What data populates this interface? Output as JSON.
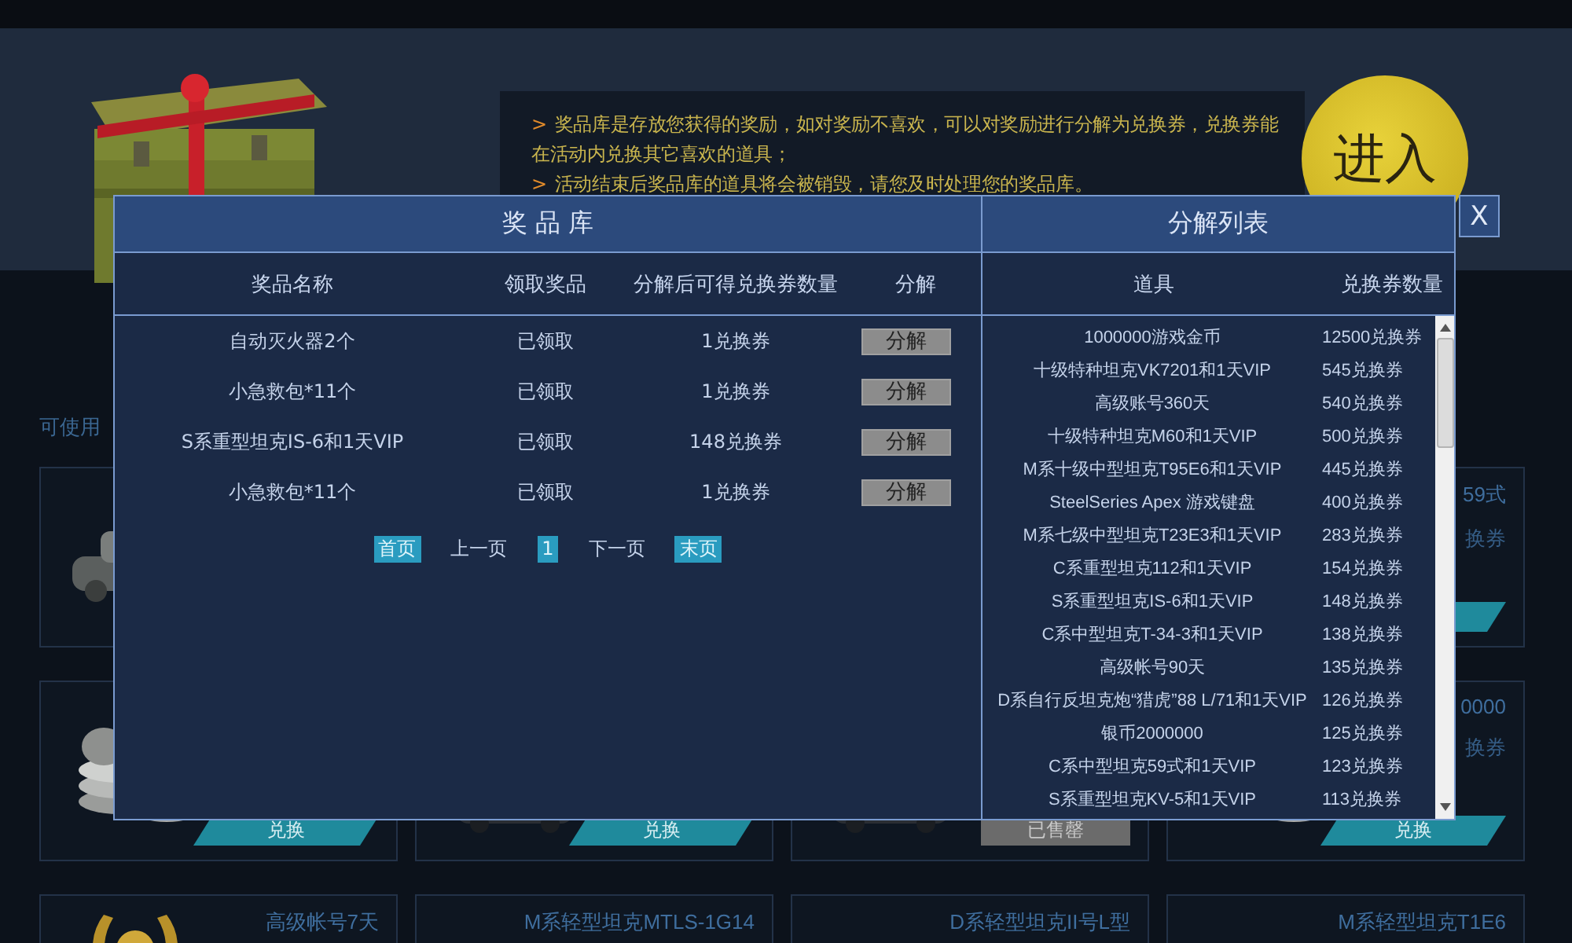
{
  "banner": {
    "notes": [
      {
        "marker": ">",
        "text": "奖品库是存放您获得的奖励，如对奖励不喜欢，可以对奖励进行分解为兑换券，兑换券能在活动内兑换其它喜欢的道具；"
      },
      {
        "marker": ">",
        "text": "活动结束后奖品库的道具将会被销毁，请您及时处理您的奖品库。"
      }
    ],
    "enter_button": "进入"
  },
  "section_label": "可使用",
  "card_rows": [
    [
      {
        "image": {
          "kind": "picture"
        }
      },
      {
        "title": "59式",
        "price": "换券",
        "button": {
          "kind": "teal"
        }
      }
    ],
    [
      {
        "image": {
          "kind": "picture"
        },
        "button": {
          "label": "兑换",
          "kind": "teal"
        }
      },
      {
        "image": {
          "kind": "picture"
        },
        "button": {
          "label": "兑换",
          "kind": "teal"
        }
      },
      {
        "image": {
          "kind": "picture"
        },
        "button": {
          "label": "已售罄",
          "kind": "grey"
        }
      },
      {
        "title": "0000",
        "price": "换券",
        "image": {
          "kind": "picture"
        },
        "button": {
          "label": "兑换",
          "kind": "teal"
        }
      }
    ],
    [
      {
        "title": "高级帐号7天",
        "image": {
          "kind": "picture"
        }
      },
      {
        "title": "M系轻型坦克MTLS-1G14"
      },
      {
        "title": "D系轻型坦克II号L型"
      },
      {
        "title": "M系轻型坦克T1E6"
      }
    ]
  ],
  "prize_library": {
    "title": "奖 品 库",
    "columns": [
      "奖品名称",
      "领取奖品",
      "分解后可得兑换券数量",
      "分解"
    ],
    "rows": [
      {
        "name": "自动灭火器2个",
        "status": "已领取",
        "vouchers": "1兑换券",
        "action": "分解"
      },
      {
        "name": "小急救包*11个",
        "status": "已领取",
        "vouchers": "1兑换券",
        "action": "分解"
      },
      {
        "name": "S系重型坦克IS-6和1天VIP",
        "status": "已领取",
        "vouchers": "148兑换券",
        "action": "分解"
      },
      {
        "name": "小急救包*11个",
        "status": "已领取",
        "vouchers": "1兑换券",
        "action": "分解"
      }
    ],
    "pagination": {
      "first": "首页",
      "prev": "上一页",
      "current": "1",
      "next": "下一页",
      "last": "末页"
    }
  },
  "decompose_list": {
    "title": "分解列表",
    "columns": [
      "道具",
      "兑换券数量"
    ],
    "rows": [
      {
        "item": "1000000游戏金币",
        "vouchers": "12500兑换券"
      },
      {
        "item": "十级特种坦克VK7201和1天VIP",
        "vouchers": "545兑换券"
      },
      {
        "item": "高级账号360天",
        "vouchers": "540兑换券"
      },
      {
        "item": "十级特种坦克M60和1天VIP",
        "vouchers": "500兑换券"
      },
      {
        "item": "M系十级中型坦克T95E6和1天VIP",
        "vouchers": "445兑换券"
      },
      {
        "item": "SteelSeries Apex 游戏键盘",
        "vouchers": "400兑换券"
      },
      {
        "item": "M系七级中型坦克T23E3和1天VIP",
        "vouchers": "283兑换券"
      },
      {
        "item": "C系重型坦克112和1天VIP",
        "vouchers": "154兑换券"
      },
      {
        "item": "S系重型坦克IS-6和1天VIP",
        "vouchers": "148兑换券"
      },
      {
        "item": "C系中型坦克T-34-3和1天VIP",
        "vouchers": "138兑换券"
      },
      {
        "item": "高级帐号90天",
        "vouchers": "135兑换券"
      },
      {
        "item": "D系自行反坦克炮“猎虎”88 L/71和1天VIP",
        "vouchers": "126兑换券"
      },
      {
        "item": "银币2000000",
        "vouchers": "125兑换券"
      },
      {
        "item": "C系中型坦克59式和1天VIP",
        "vouchers": "123兑换券"
      },
      {
        "item": "S系重型坦克KV-5和1天VIP",
        "vouchers": "113兑换券"
      }
    ]
  },
  "close_button": "X"
}
